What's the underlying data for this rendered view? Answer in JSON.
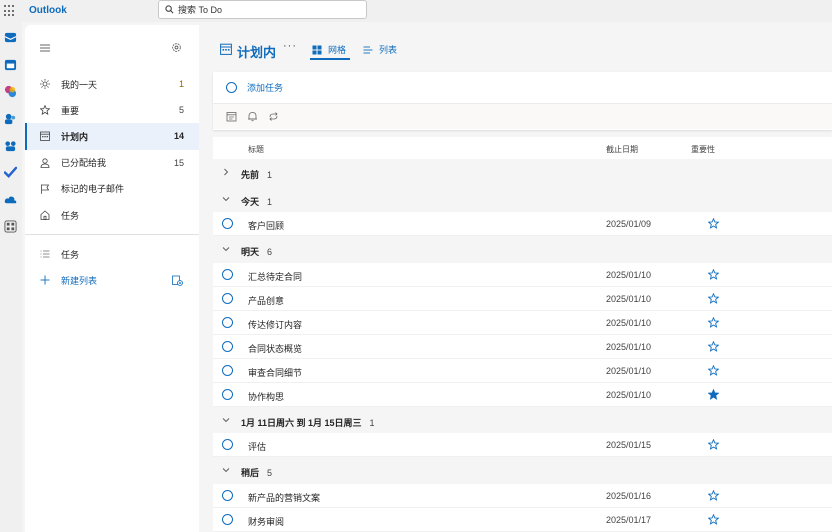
{
  "app": {
    "title": "Outlook"
  },
  "search": {
    "placeholder": "搜索 To Do"
  },
  "rail": {
    "icons": [
      "mail-icon",
      "calendar-icon",
      "copilot-icon",
      "people-icon",
      "groups-icon",
      "todo-icon",
      "onedrive-icon",
      "apps-icon"
    ]
  },
  "sidebar": {
    "items": [
      {
        "label": "我的一天",
        "count": "1",
        "icon": "sun-icon",
        "active": false
      },
      {
        "label": "重要",
        "count": "5",
        "icon": "star-icon",
        "active": false
      },
      {
        "label": "计划内",
        "count": "14",
        "icon": "calendar-grid-icon",
        "active": true
      },
      {
        "label": "已分配给我",
        "count": "15",
        "icon": "person-icon",
        "active": false
      },
      {
        "label": "标记的电子邮件",
        "count": "",
        "icon": "flag-icon",
        "active": false
      },
      {
        "label": "任务",
        "count": "",
        "icon": "home-icon",
        "active": false
      }
    ],
    "lists": [
      {
        "label": "任务",
        "icon": "list-icon"
      }
    ],
    "new_list_label": "新建列表"
  },
  "main": {
    "title": "计划内",
    "more": "···",
    "tabs": {
      "grid_label": "网格",
      "list_label": "列表"
    },
    "add_placeholder": "添加任务",
    "columns": {
      "title": "标题",
      "due": "截止日期",
      "importance": "重要性"
    },
    "groups": [
      {
        "label": "先前",
        "count": "1",
        "expanded": false,
        "tasks": []
      },
      {
        "label": "今天",
        "count": "1",
        "expanded": true,
        "tasks": [
          {
            "title": "客户回顾",
            "date": "2025/01/09",
            "important": false
          }
        ]
      },
      {
        "label": "明天",
        "count": "6",
        "expanded": true,
        "tasks": [
          {
            "title": "汇总待定合同",
            "date": "2025/01/10",
            "important": false
          },
          {
            "title": "产品创意",
            "date": "2025/01/10",
            "important": false
          },
          {
            "title": "传达修订内容",
            "date": "2025/01/10",
            "important": false
          },
          {
            "title": "合同状态概览",
            "date": "2025/01/10",
            "important": false
          },
          {
            "title": "审查合同细节",
            "date": "2025/01/10",
            "important": false
          },
          {
            "title": "协作构思",
            "date": "2025/01/10",
            "important": true
          }
        ]
      },
      {
        "label": "1月 11日周六 到 1月 15日周三",
        "count": "1",
        "expanded": true,
        "tasks": [
          {
            "title": "评估",
            "date": "2025/01/15",
            "important": false
          }
        ]
      },
      {
        "label": "稍后",
        "count": "5",
        "expanded": true,
        "tasks": [
          {
            "title": "新产品的营销文案",
            "date": "2025/01/16",
            "important": false
          },
          {
            "title": "财务审阅",
            "date": "2025/01/17",
            "important": false
          }
        ]
      }
    ]
  },
  "colors": {
    "accent": "#0f6cbd",
    "background": "#f5f5f5",
    "panel": "#ffffff"
  }
}
